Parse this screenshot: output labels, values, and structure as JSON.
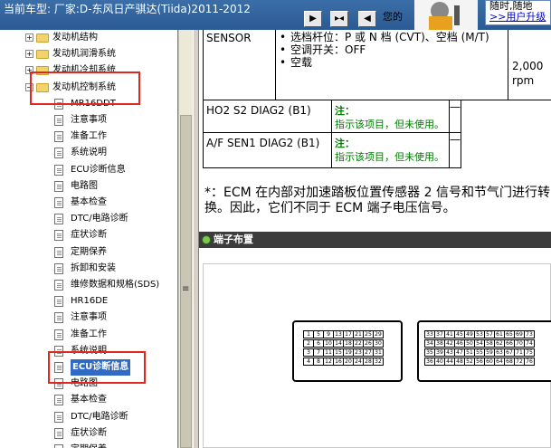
{
  "titlebar": {
    "vehicle": "当前车型:  厂家:D-东风日产骐达(Tiida)2011-2012",
    "hint": "您的",
    "tips_line1": "随时,随地",
    "tips_link": ">>用户升级"
  },
  "tree": {
    "top_items": [
      {
        "label": "发动机结构"
      },
      {
        "label": "发动机润滑系统"
      },
      {
        "label": "发动机冷却系统"
      },
      {
        "label": "发动机控制系统"
      }
    ],
    "group1_title": "MR16DDT",
    "group1": [
      "注意事项",
      "准备工作",
      "系统说明",
      "ECU诊断信息",
      "电路图",
      "基本检查",
      "DTC/电路诊断",
      "症状诊断",
      "定期保养",
      "拆卸和安装",
      "维修数据和规格(SDS)"
    ],
    "group2_title": "HR16DE",
    "group2": [
      "注意事项",
      "准备工作",
      "系统说明",
      "ECU诊断信息",
      "电路图",
      "基本检查",
      "DTC/电路诊断",
      "症状诊断",
      "定期保养"
    ]
  },
  "content": {
    "sensor_label": "SENSOR",
    "conditions": [
      "选档杆位：P 或 N 档 (CVT)、空档 (M/T)",
      "空调开关：OFF",
      "空载"
    ],
    "rpm_value": "2,000",
    "rpm_unit": "rpm",
    "row2_label": "HO2 S2 DIAG2 (B1)",
    "row3_label": "A/F SEN1 DIAG2 (B1)",
    "note_title": "注：",
    "note_text": "指示该项目，但未使用。",
    "dash": "—",
    "footnote": "*：ECM 在内部对加速踏板位置传感器 2 信号和节气门进行转换。因此，它们不同于 ECM 端子电压信号。",
    "section_title": "端子布置"
  },
  "connector": {
    "left_rows": [
      [
        "1",
        "5",
        "9",
        "13",
        "17",
        "21",
        "25",
        "29"
      ],
      [
        "2",
        "6",
        "10",
        "14",
        "18",
        "22",
        "26",
        "30"
      ],
      [
        "3",
        "7",
        "11",
        "15",
        "19",
        "23",
        "27",
        "31"
      ],
      [
        "4",
        "8",
        "12",
        "16",
        "20",
        "24",
        "28",
        "32"
      ]
    ],
    "right_rows": [
      [
        "33",
        "37",
        "41",
        "45",
        "49",
        "53",
        "57",
        "61",
        "65",
        "69",
        "73"
      ],
      [
        "34",
        "38",
        "42",
        "46",
        "50",
        "54",
        "58",
        "62",
        "66",
        "70",
        "74"
      ],
      [
        "35",
        "39",
        "43",
        "47",
        "51",
        "55",
        "59",
        "63",
        "67",
        "71",
        "75"
      ],
      [
        "36",
        "40",
        "44",
        "48",
        "52",
        "56",
        "60",
        "64",
        "68",
        "72",
        "76"
      ]
    ]
  },
  "colors": {
    "highlight_box": "#e0281f",
    "selection": "#316ac5",
    "note_green": "#007a00"
  }
}
